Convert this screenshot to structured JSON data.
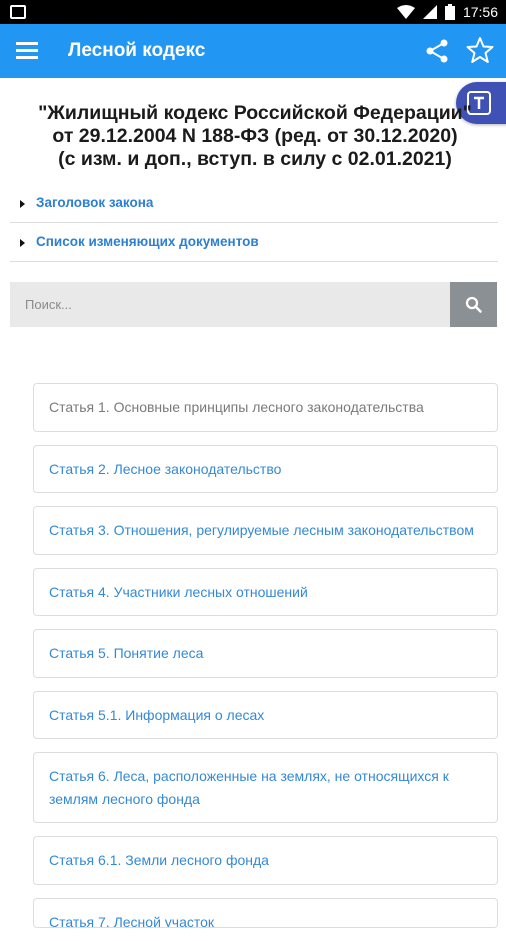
{
  "status_bar": {
    "time": "17:56",
    "icons": [
      "notification-icon",
      "wifi-icon",
      "signal-icon",
      "battery-icon"
    ]
  },
  "app_bar": {
    "title": "Лесной кодекс",
    "color": "#2196f3",
    "icons": [
      "menu-icon",
      "share-icon",
      "star-icon"
    ]
  },
  "fab": {
    "icon": "translate-icon",
    "color": "#3f51b5"
  },
  "document": {
    "title_lines": [
      "\"Жилищный кодекс Российской Федерации\"",
      "от 29.12.2004 N 188-ФЗ (ред. от 30.12.2020)",
      "(с изм. и доп., вступ. в силу с 02.01.2021)"
    ]
  },
  "sections": [
    {
      "label": "Заголовок закона"
    },
    {
      "label": "Список изменяющих документов"
    }
  ],
  "search": {
    "placeholder": "Поиск...",
    "icon": "search-icon"
  },
  "articles": [
    {
      "label": "Статья 1. Основные принципы лесного законодательства"
    },
    {
      "label": "Статья 2. Лесное законодательство"
    },
    {
      "label": "Статья 3. Отношения, регулируемые лесным законодательством"
    },
    {
      "label": "Статья 4. Участники лесных отношений"
    },
    {
      "label": "Статья 5. Понятие леса"
    },
    {
      "label": "Статья 5.1. Информация о лесах"
    },
    {
      "label": "Статья 6. Леса, расположенные на землях, не относящихся к землям лесного фонда"
    },
    {
      "label": "Статья 6.1. Земли лесного фонда"
    },
    {
      "label": "Статья 7. Лесной участок"
    }
  ]
}
